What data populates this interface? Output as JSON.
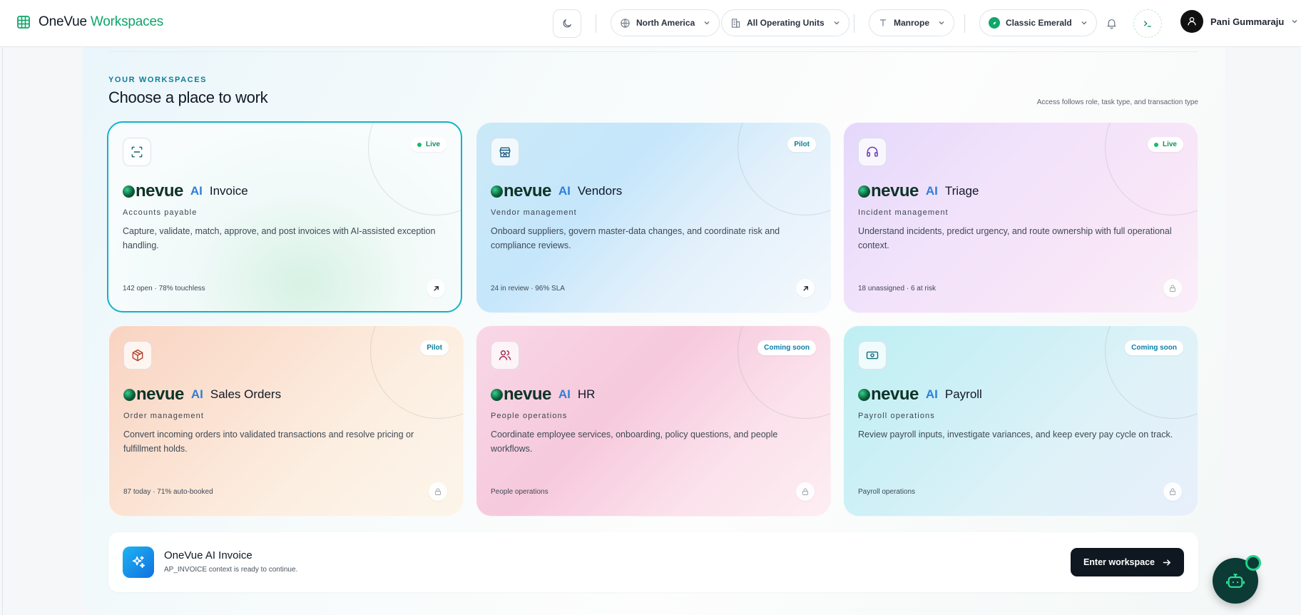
{
  "header": {
    "brand_primary": "OneVue",
    "brand_secondary": "Workspaces",
    "region": "North America",
    "operating_units": "All Operating Units",
    "font": "Manrope",
    "theme": "Classic Emerald",
    "user_name": "Pani Gummaraju"
  },
  "hero": {
    "eyebrow": "YOUR WORKSPACES",
    "title": "Choose a place to work",
    "access_note": "Access follows role, task type, and transaction type"
  },
  "logo": {
    "wordmark": "nevue",
    "ai": "AI"
  },
  "cards": [
    {
      "product": "Invoice",
      "subtitle": "Accounts payable",
      "badge": "Live",
      "description": "Capture, validate, match, approve, and post invoices with AI-assisted exception handling.",
      "stat": "142 open · 78% touchless",
      "icon": "scan-icon",
      "action": "open"
    },
    {
      "product": "Vendors",
      "subtitle": "Vendor management",
      "badge": "Pilot",
      "description": "Onboard suppliers, govern master-data changes, and coordinate risk and compliance reviews.",
      "stat": "24 in review · 96% SLA",
      "icon": "store-icon",
      "action": "open"
    },
    {
      "product": "Triage",
      "subtitle": "Incident management",
      "badge": "Live",
      "description": "Understand incidents, predict urgency, and route ownership with full operational context.",
      "stat": "18 unassigned · 6 at risk",
      "icon": "headset-icon",
      "action": "locked"
    },
    {
      "product": "Sales Orders",
      "subtitle": "Order management",
      "badge": "Pilot",
      "description": "Convert incoming orders into validated transactions and resolve pricing or fulfillment holds.",
      "stat": "87 today · 71% auto-booked",
      "icon": "package-icon",
      "action": "locked"
    },
    {
      "product": "HR",
      "subtitle": "People operations",
      "badge": "Coming soon",
      "description": "Coordinate employee services, onboarding, policy questions, and people workflows.",
      "stat": "People operations",
      "icon": "users-icon",
      "action": "locked"
    },
    {
      "product": "Payroll",
      "subtitle": "Payroll operations",
      "badge": "Coming soon",
      "description": "Review payroll inputs, investigate variances, and keep every pay cycle on track.",
      "stat": "Payroll operations",
      "icon": "banknote-icon",
      "action": "locked"
    }
  ],
  "footer": {
    "title": "OneVue AI Invoice",
    "subtitle": "AP_INVOICE context is ready to continue.",
    "button_label": "Enter workspace"
  },
  "colors": {
    "accent": "#0ea56b",
    "selected_border": "#10b3cc",
    "ai_blue": "#2f7fd8",
    "button_dark": "#0f1720"
  }
}
